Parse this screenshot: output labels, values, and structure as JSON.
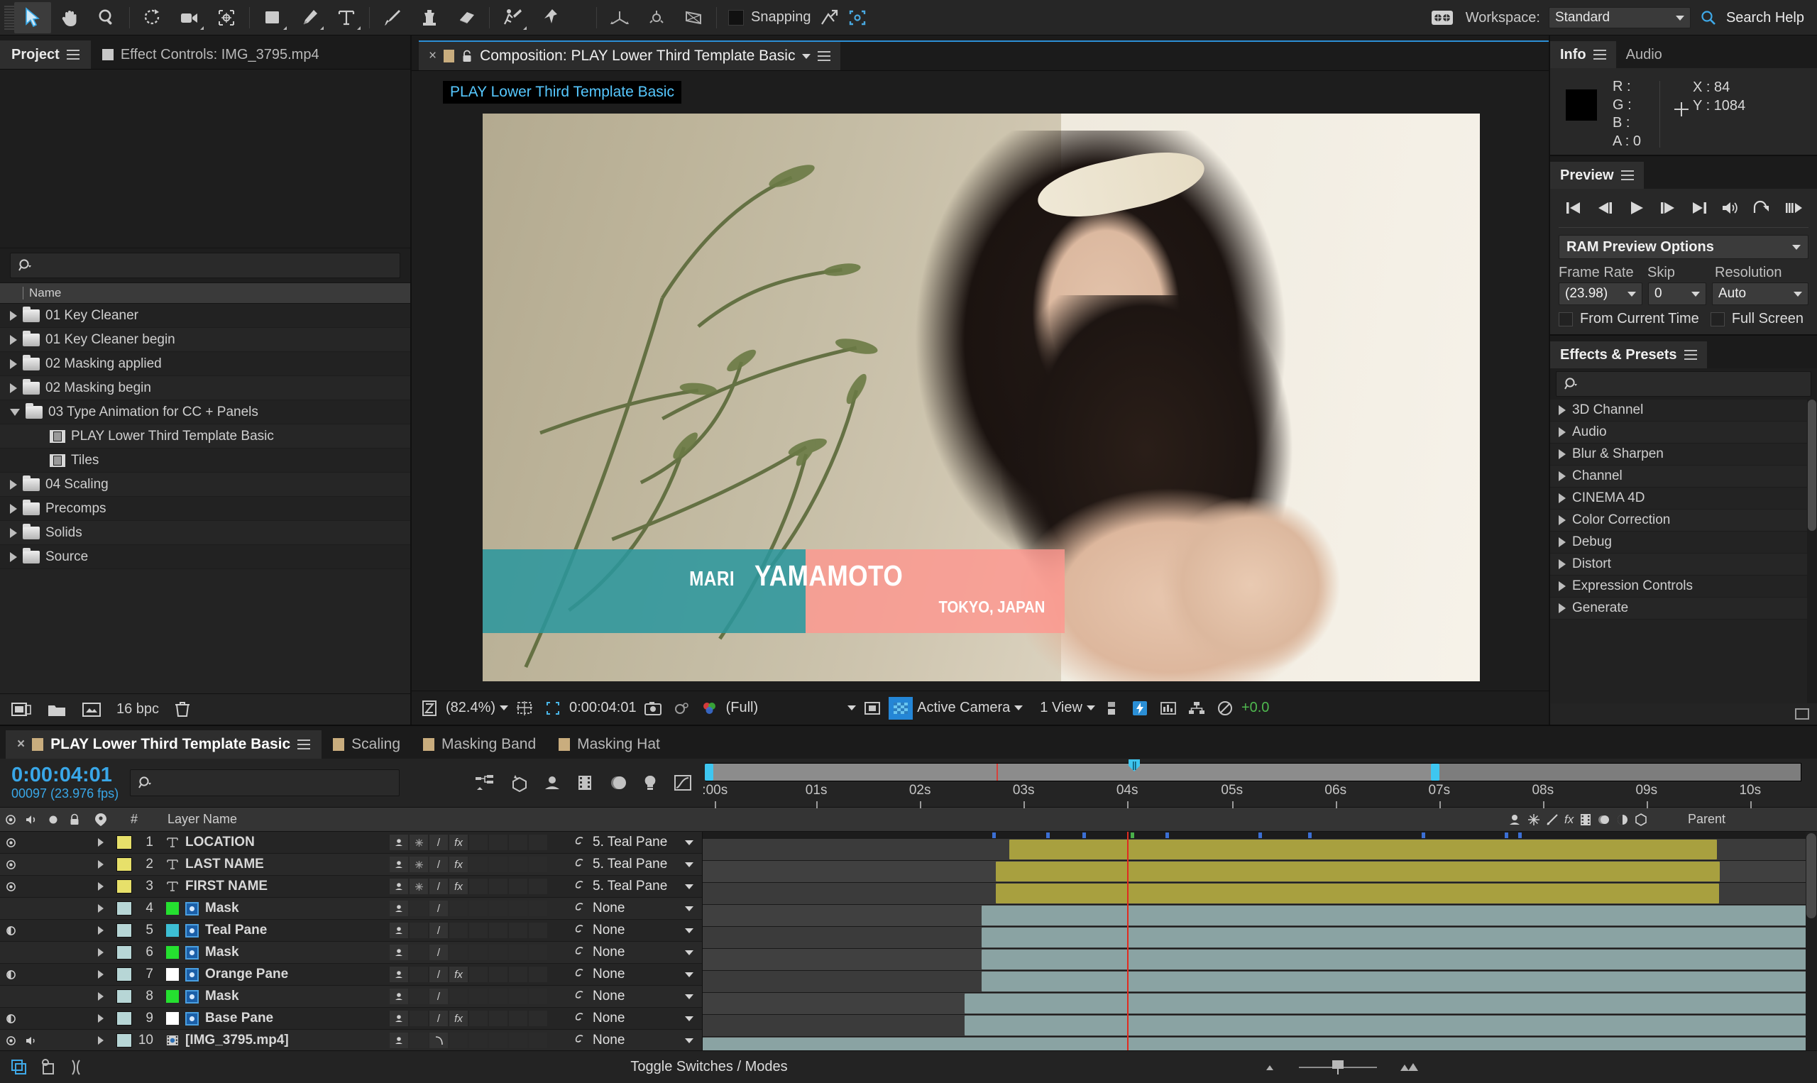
{
  "toolbar": {
    "tools": [
      {
        "name": "selection-tool",
        "glyph": "arrow",
        "selected": true
      },
      {
        "name": "hand-tool",
        "glyph": "hand",
        "selected": false
      },
      {
        "name": "zoom-tool",
        "glyph": "magnifier",
        "selected": false
      },
      {
        "name": "rotation-tool",
        "glyph": "rotate",
        "selected": false
      },
      {
        "name": "camera-tool",
        "glyph": "camera",
        "selected": false
      },
      {
        "name": "pan-behind-tool",
        "glyph": "anchor",
        "selected": false
      },
      {
        "name": "shape-tool",
        "glyph": "rect",
        "selected": false
      },
      {
        "name": "pen-tool",
        "glyph": "pen",
        "selected": false
      },
      {
        "name": "type-tool",
        "glyph": "type",
        "selected": false
      },
      {
        "name": "brush-tool",
        "glyph": "brush",
        "selected": false
      },
      {
        "name": "clone-stamp-tool",
        "glyph": "stamp",
        "selected": false
      },
      {
        "name": "eraser-tool",
        "glyph": "eraser",
        "selected": false
      },
      {
        "name": "roto-brush-tool",
        "glyph": "roto",
        "selected": false
      },
      {
        "name": "puppet-pin-tool",
        "glyph": "pin",
        "selected": false
      }
    ],
    "snapping_label": "Snapping",
    "snapping_checked": false,
    "workspace_label": "Workspace:",
    "workspace_value": "Standard",
    "search_help": "Search Help"
  },
  "project": {
    "tabs": [
      {
        "label": "Project",
        "active": true
      },
      {
        "label": "Effect Controls: IMG_3795.mp4",
        "active": false
      }
    ],
    "search_placeholder": "",
    "column_header": "Name",
    "items": [
      {
        "label": "01 Key Cleaner",
        "type": "folder",
        "expanded": false,
        "indent": 0
      },
      {
        "label": "01 Key Cleaner begin",
        "type": "folder",
        "expanded": false,
        "indent": 0
      },
      {
        "label": "02 Masking applied",
        "type": "folder",
        "expanded": false,
        "indent": 0
      },
      {
        "label": "02 Masking begin",
        "type": "folder",
        "expanded": false,
        "indent": 0
      },
      {
        "label": "03 Type Animation for CC + Panels",
        "type": "folder",
        "expanded": true,
        "indent": 0
      },
      {
        "label": "PLAY Lower Third Template Basic",
        "type": "comp",
        "expanded": false,
        "indent": 1
      },
      {
        "label": "Tiles",
        "type": "comp",
        "expanded": false,
        "indent": 1
      },
      {
        "label": "04 Scaling",
        "type": "folder",
        "expanded": false,
        "indent": 0
      },
      {
        "label": "Precomps",
        "type": "folder",
        "expanded": false,
        "indent": 0
      },
      {
        "label": "Solids",
        "type": "folder",
        "expanded": false,
        "indent": 0
      },
      {
        "label": "Source",
        "type": "folder",
        "expanded": false,
        "indent": 0
      }
    ],
    "footer": {
      "bpc": "16 bpc"
    }
  },
  "composition": {
    "tab_title": "Composition: PLAY Lower Third Template Basic",
    "name_badge": "PLAY Lower Third Template Basic",
    "lower_third": {
      "first_name": "MARI",
      "last_name": "YAMAMOTO",
      "location": "TOKYO, JAPAN",
      "teal_color": "#2a969d",
      "pink_color": "#ff968f"
    },
    "viewer_bar": {
      "zoom": "(82.4%)",
      "timecode": "0:00:04:01",
      "resolution": "(Full)",
      "camera": "Active Camera",
      "views": "1 View",
      "exposure": "+0.0"
    }
  },
  "info": {
    "tabs": [
      {
        "label": "Info",
        "active": true
      },
      {
        "label": "Audio",
        "active": false
      }
    ],
    "r": "R :",
    "g": "G :",
    "b": "B :",
    "a": "A : 0",
    "x": "X : 84",
    "y": "Y : 1084",
    "swatch_color": "#000000"
  },
  "preview": {
    "title": "Preview",
    "buttons": [
      "first-frame",
      "prev-frame",
      "play",
      "next-frame",
      "last-frame",
      "audio",
      "ram-preview",
      "loop"
    ],
    "ram_preview_options": "RAM Preview Options",
    "frame_rate_label": "Frame Rate",
    "skip_label": "Skip",
    "resolution_label": "Resolution",
    "frame_rate_value": "(23.98)",
    "skip_value": "0",
    "resolution_value": "Auto",
    "from_current_time": "From Current Time",
    "full_screen": "Full Screen"
  },
  "effects": {
    "title": "Effects & Presets",
    "search_placeholder": "",
    "categories": [
      "3D Channel",
      "Audio",
      "Blur & Sharpen",
      "Channel",
      "CINEMA 4D",
      "Color Correction",
      "Debug",
      "Distort",
      "Expression Controls",
      "Generate"
    ]
  },
  "timeline": {
    "tabs": [
      {
        "label": "PLAY Lower Third Template Basic",
        "active": true
      },
      {
        "label": "Scaling",
        "active": false
      },
      {
        "label": "Masking Band",
        "active": false
      },
      {
        "label": "Masking Hat",
        "active": false
      }
    ],
    "timecode": "0:00:04:01",
    "frame_info": "00097 (23.976 fps)",
    "search_placeholder": "",
    "columns": {
      "num": "#",
      "layer_name": "Layer Name",
      "parent": "Parent"
    },
    "ruler_ticks": [
      ":00s",
      "01s",
      "02s",
      "03s",
      "04s",
      "05s",
      "06s",
      "07s",
      "08s",
      "09s",
      "10s"
    ],
    "layers": [
      {
        "num": "1",
        "name": "LOCATION",
        "type": "text",
        "color": "#e7e06a",
        "visible": true,
        "audio": false,
        "switches": [
          "shy",
          "cc",
          "quality",
          "fx"
        ],
        "parent": "5. Teal Pane",
        "bar_start_pct": 27.5,
        "bar_end_pct": 91.0,
        "bar_color": "yellow"
      },
      {
        "num": "2",
        "name": "LAST NAME",
        "type": "text",
        "color": "#e7e06a",
        "visible": true,
        "audio": false,
        "switches": [
          "shy",
          "cc",
          "quality",
          "fx"
        ],
        "parent": "5. Teal Pane",
        "bar_start_pct": 26.3,
        "bar_end_pct": 91.3,
        "bar_color": "yellow"
      },
      {
        "num": "3",
        "name": "FIRST NAME",
        "type": "text",
        "color": "#e7e06a",
        "visible": true,
        "audio": false,
        "switches": [
          "shy",
          "cc",
          "quality",
          "fx"
        ],
        "parent": "5. Teal Pane",
        "bar_start_pct": 26.3,
        "bar_end_pct": 91.2,
        "bar_color": "yellow"
      },
      {
        "num": "4",
        "name": "Mask",
        "type": "solid",
        "color": "#b7d6d6",
        "swatch": "#25e030",
        "visible": false,
        "audio": false,
        "switches": [
          "shy",
          "",
          "quality",
          ""
        ],
        "parent": "None",
        "bar_start_pct": 25.0,
        "bar_end_pct": 100,
        "bar_color": "teal"
      },
      {
        "num": "5",
        "name": "Teal Pane",
        "type": "solid",
        "color": "#b7d6d6",
        "swatch": "#3dbfd4",
        "visible": true,
        "audio": false,
        "switches": [
          "shy",
          "",
          "quality",
          ""
        ],
        "parent": "None",
        "bar_start_pct": 25.0,
        "bar_end_pct": 100,
        "bar_color": "teal"
      },
      {
        "num": "6",
        "name": "Mask",
        "type": "solid",
        "color": "#b7d6d6",
        "swatch": "#25e030",
        "visible": false,
        "audio": false,
        "switches": [
          "shy",
          "",
          "quality",
          ""
        ],
        "parent": "None",
        "bar_start_pct": 25.0,
        "bar_end_pct": 100,
        "bar_color": "teal"
      },
      {
        "num": "7",
        "name": "Orange Pane",
        "type": "solid",
        "color": "#b7d6d6",
        "swatch": "#ffffff",
        "visible": true,
        "audio": false,
        "switches": [
          "shy",
          "",
          "quality",
          "fx"
        ],
        "parent": "None",
        "bar_start_pct": 25.0,
        "bar_end_pct": 100,
        "bar_color": "teal"
      },
      {
        "num": "8",
        "name": "Mask",
        "type": "solid",
        "color": "#b7d6d6",
        "swatch": "#25e030",
        "visible": false,
        "audio": false,
        "switches": [
          "shy",
          "",
          "quality",
          ""
        ],
        "parent": "None",
        "bar_start_pct": 23.5,
        "bar_end_pct": 100,
        "bar_color": "teal"
      },
      {
        "num": "9",
        "name": "Base Pane",
        "type": "solid",
        "color": "#b7d6d6",
        "swatch": "#ffffff",
        "visible": true,
        "audio": false,
        "switches": [
          "shy",
          "",
          "quality",
          "fx"
        ],
        "parent": "None",
        "bar_start_pct": 23.5,
        "bar_end_pct": 100,
        "bar_color": "teal"
      },
      {
        "num": "10",
        "name": "[IMG_3795.mp4]",
        "type": "footage",
        "color": "#b7d6d6",
        "visible": true,
        "audio": true,
        "switches": [
          "shy",
          "",
          "curve",
          ""
        ],
        "parent": "None",
        "bar_start_pct": 0,
        "bar_end_pct": 100,
        "bar_color": "teal"
      }
    ],
    "footer_label": "Toggle Switches / Modes"
  }
}
